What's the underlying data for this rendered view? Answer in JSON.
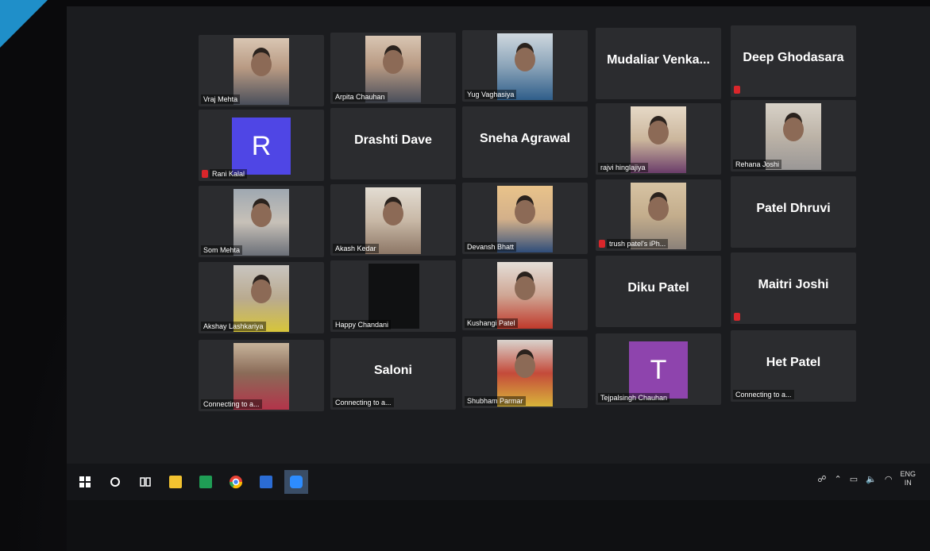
{
  "colors": {
    "accent": "#2d8cff",
    "mute": "#d9262b",
    "avatar_r": "#4f46e5",
    "avatar_t": "#8e44ad"
  },
  "tiles": [
    {
      "label": "Vraj Mehta"
    },
    {
      "label": "Arpita Chauhan"
    },
    {
      "label": "Yug Vaghasiya"
    },
    {
      "big": "Mudaliar  Venka..."
    },
    {
      "big": "Deep Ghodasara"
    },
    {
      "avatar": "R",
      "label": "Rani Kalal"
    },
    {
      "big": "Drashti Dave"
    },
    {
      "big": "Sneha Agrawal"
    },
    {
      "label": "rajvi hinglajiya"
    },
    {
      "label": "Rehana Joshi"
    },
    {
      "label": "Som Mehta"
    },
    {
      "label": "Akash Kedar"
    },
    {
      "label": "Devansh Bhatt"
    },
    {
      "label": "trush patel's iPh..."
    },
    {
      "big": "Patel Dhruvi"
    },
    {
      "label": "Akshay Lashkariya"
    },
    {
      "label": "Happy Chandani"
    },
    {
      "label": "Kushangi Patel"
    },
    {
      "big": "Diku Patel"
    },
    {
      "big": "Maitri Joshi"
    },
    {
      "label": "Connecting to a..."
    },
    {
      "big": "Saloni",
      "label": "Connecting to a..."
    },
    {
      "label": "Shubham Parmar"
    },
    {
      "avatar": "T",
      "label": "Tejpalsingh Chauhan"
    },
    {
      "big": "Het Patel",
      "label": "Connecting to a..."
    }
  ],
  "taskbar": {
    "lang_top": "ENG",
    "lang_bottom": "IN"
  }
}
